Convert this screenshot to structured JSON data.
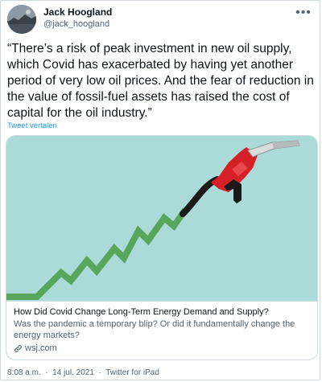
{
  "author": {
    "display_name": "Jack Hoogland",
    "handle": "@jack_hoogland"
  },
  "menu": {
    "more_label": "•••",
    "icon": "more-icon"
  },
  "tweet": {
    "text": "“There’s a risk of peak investment in new oil supply, which Covid has exacerbated by having yet another period of very low oil prices. And the fear of reduction in the value of fossil-fuel assets has raised the cost of capital for the oil industry.”",
    "translate_label": "Tweet vertalen"
  },
  "card": {
    "title": "How Did Covid Change Long-Term Energy Demand and Supply?",
    "description": "Was the pandemic a temporary blip? Or did it fundamentally change the energy markets?",
    "domain": "wsj.com",
    "domain_icon": "link-icon",
    "image_colors": {
      "background": "#abdbd8",
      "line": "#58a55c",
      "nozzle": "#d62027",
      "hose": "#1a1a1a"
    }
  },
  "footer": {
    "time": "8:08 a.m.",
    "separator": "·",
    "date": "14 jul. 2021",
    "source": "Twitter for iPad"
  }
}
